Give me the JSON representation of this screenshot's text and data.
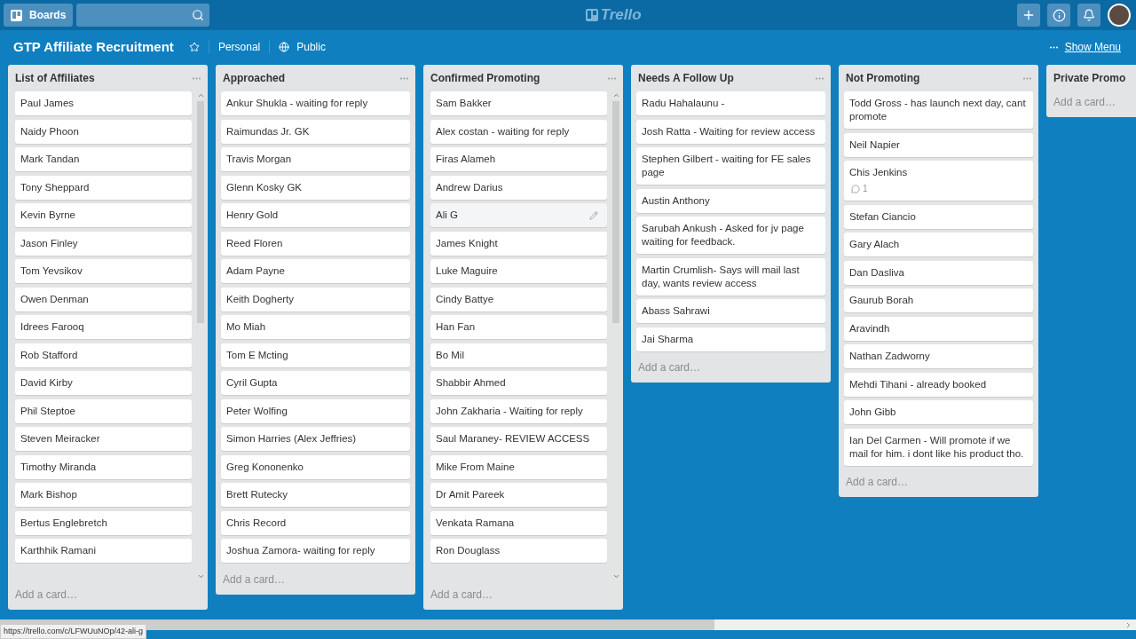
{
  "header": {
    "boards_button": "Boards",
    "logo": "Trello"
  },
  "board": {
    "title": "GTP Affiliate Recruitment",
    "starred": false,
    "team": "Personal",
    "visibility": "Public",
    "show_menu": "Show Menu"
  },
  "lists": [
    {
      "title": "List of Affiliates",
      "scrollable": true,
      "add_card": "Add a card…",
      "cards": [
        {
          "text": "Paul James"
        },
        {
          "text": "Naidy Phoon"
        },
        {
          "text": "Mark Tandan"
        },
        {
          "text": "Tony Sheppard"
        },
        {
          "text": "Kevin Byrne"
        },
        {
          "text": "Jason Finley"
        },
        {
          "text": "Tom Yevsikov"
        },
        {
          "text": "Owen Denman"
        },
        {
          "text": "Idrees Farooq"
        },
        {
          "text": "Rob Stafford"
        },
        {
          "text": "David Kirby"
        },
        {
          "text": "Phil Steptoe"
        },
        {
          "text": "Steven Meiracker"
        },
        {
          "text": "Timothy Miranda"
        },
        {
          "text": "Mark Bishop"
        },
        {
          "text": "Bertus Englebretch"
        },
        {
          "text": "Karthhik Ramani"
        }
      ]
    },
    {
      "title": "Approached",
      "scrollable": false,
      "add_card": "Add a card…",
      "cards": [
        {
          "text": "Ankur Shukla - waiting for reply"
        },
        {
          "text": "Raimundas Jr. GK"
        },
        {
          "text": "Travis Morgan"
        },
        {
          "text": "Glenn Kosky GK"
        },
        {
          "text": "Henry Gold"
        },
        {
          "text": "Reed Floren"
        },
        {
          "text": "Adam Payne"
        },
        {
          "text": "Keith Dogherty"
        },
        {
          "text": "Mo Miah"
        },
        {
          "text": "Tom E Mcting"
        },
        {
          "text": "Cyril Gupta"
        },
        {
          "text": "Peter Wolfing"
        },
        {
          "text": "Simon Harries (Alex Jeffries)"
        },
        {
          "text": "Greg Kononenko"
        },
        {
          "text": "Brett Rutecky"
        },
        {
          "text": "Chris Record"
        },
        {
          "text": "Joshua Zamora- waiting for reply"
        }
      ]
    },
    {
      "title": "Confirmed Promoting",
      "scrollable": true,
      "add_card": "Add a card…",
      "cards": [
        {
          "text": "Sam Bakker"
        },
        {
          "text": "Alex costan - waiting for reply"
        },
        {
          "text": "Firas Alameh"
        },
        {
          "text": "Andrew Darius"
        },
        {
          "text": "Ali G",
          "hovered": true
        },
        {
          "text": "James Knight"
        },
        {
          "text": "Luke Maguire"
        },
        {
          "text": "Cindy Battye"
        },
        {
          "text": "Han Fan"
        },
        {
          "text": "Bo Mil"
        },
        {
          "text": "Shabbir Ahmed"
        },
        {
          "text": "John Zakharia - Waiting for reply"
        },
        {
          "text": "Saul Maraney- REVIEW ACCESS"
        },
        {
          "text": "Mike From Maine"
        },
        {
          "text": "Dr Amit Pareek"
        },
        {
          "text": "Venkata Ramana"
        },
        {
          "text": "Ron Douglass"
        }
      ]
    },
    {
      "title": "Needs A Follow Up",
      "scrollable": false,
      "add_card": "Add a card…",
      "cards": [
        {
          "text": "Radu Hahalaunu -"
        },
        {
          "text": "Josh Ratta - Waiting for review access"
        },
        {
          "text": "Stephen Gilbert - waiting for FE sales page"
        },
        {
          "text": "Austin Anthony"
        },
        {
          "text": "Sarubah Ankush - Asked for jv page waiting for feedback."
        },
        {
          "text": "Martin Crumlish- Says will mail last day, wants review access"
        },
        {
          "text": "Abass Sahrawi"
        },
        {
          "text": "Jai Sharma"
        }
      ]
    },
    {
      "title": "Not Promoting",
      "scrollable": false,
      "add_card": "Add a card…",
      "cards": [
        {
          "text": "Todd Gross - has launch next day, cant promote"
        },
        {
          "text": "Neil Napier"
        },
        {
          "text": "Chis Jenkins",
          "comments": "1"
        },
        {
          "text": "Stefan Ciancio"
        },
        {
          "text": "Gary Alach"
        },
        {
          "text": "Dan Dasliva"
        },
        {
          "text": "Gaurub Borah"
        },
        {
          "text": "Aravindh"
        },
        {
          "text": "Nathan Zadworny"
        },
        {
          "text": "Mehdi Tihani - already booked"
        },
        {
          "text": "John Gibb"
        },
        {
          "text": "Ian Del Carmen - Will promote if we mail for him. i dont like his product tho."
        }
      ]
    },
    {
      "title": "Private Promo",
      "scrollable": false,
      "add_card": "Add a card…"
    }
  ],
  "status_url": "https://trello.com/c/LFWUuNOp/42-ali-g"
}
